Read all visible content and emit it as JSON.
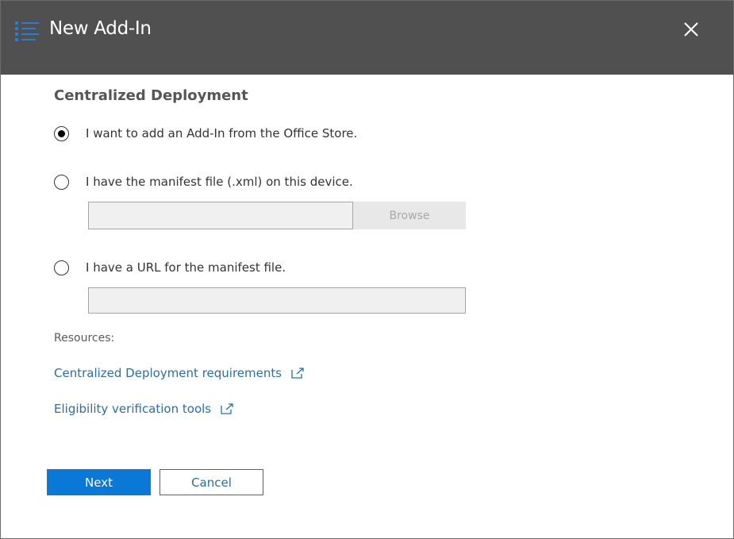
{
  "dialog": {
    "title": "New Add-In",
    "title_icon": "list-icon",
    "close_icon": "close-icon"
  },
  "section": {
    "title": "Centralized Deployment"
  },
  "options": [
    {
      "label": "I want to add an Add-In from the Office Store.",
      "selected": true
    },
    {
      "label": "I have the manifest file (.xml) on this device.",
      "selected": false
    },
    {
      "label": "I have a URL for the manifest file.",
      "selected": false
    }
  ],
  "manifest_file": {
    "value": "",
    "placeholder": "",
    "browse_label": "Browse"
  },
  "manifest_url": {
    "value": "",
    "placeholder": ""
  },
  "resources": {
    "label": "Resources:",
    "links": [
      {
        "label": "Centralized Deployment requirements",
        "icon": "external-link-icon"
      },
      {
        "label": "Eligibility verification tools",
        "icon": "external-link-icon"
      }
    ]
  },
  "footer": {
    "next_label": "Next",
    "cancel_label": "Cancel"
  },
  "colors": {
    "titlebar": "#505050",
    "accent": "#0a78d7",
    "link": "#2b6ea6",
    "icon_blue": "#2b7cd3"
  }
}
